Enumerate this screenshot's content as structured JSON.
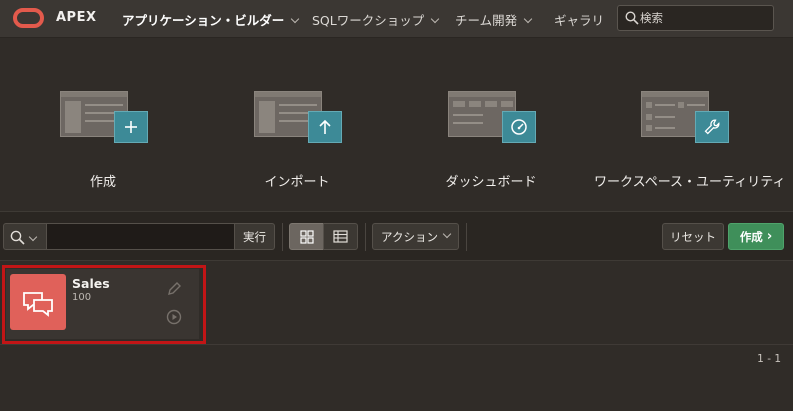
{
  "topbar": {
    "brand": "APEX",
    "nav": [
      "アプリケーション・ビルダー",
      "SQLワークショップ",
      "チーム開発",
      "ギャラリ"
    ],
    "search_placeholder": "検索"
  },
  "tiles": [
    "作成",
    "インポート",
    "ダッシュボード",
    "ワークスペース・ユーティリティ"
  ],
  "toolbar": {
    "search_value": "",
    "run_label": "実行",
    "action_label": "アクション",
    "reset_label": "リセット",
    "create_label": "作成"
  },
  "apps": [
    {
      "name": "Sales",
      "id": "100"
    }
  ],
  "pagination": "1 - 1",
  "colors": {
    "background": "#302c28",
    "accent_teal": "#3d8a97",
    "create_green": "#3f8f5a",
    "app_icon": "#e0615a",
    "highlight_red": "#c21516",
    "logo": "#e35a4c"
  },
  "icons": [
    "logo-icon",
    "search-icon",
    "plus-icon",
    "upload-arrow-icon",
    "gauge-icon",
    "wrench-icon",
    "grid-view-icon",
    "report-view-icon",
    "chat-bubbles-icon",
    "pencil-icon",
    "play-icon"
  ]
}
